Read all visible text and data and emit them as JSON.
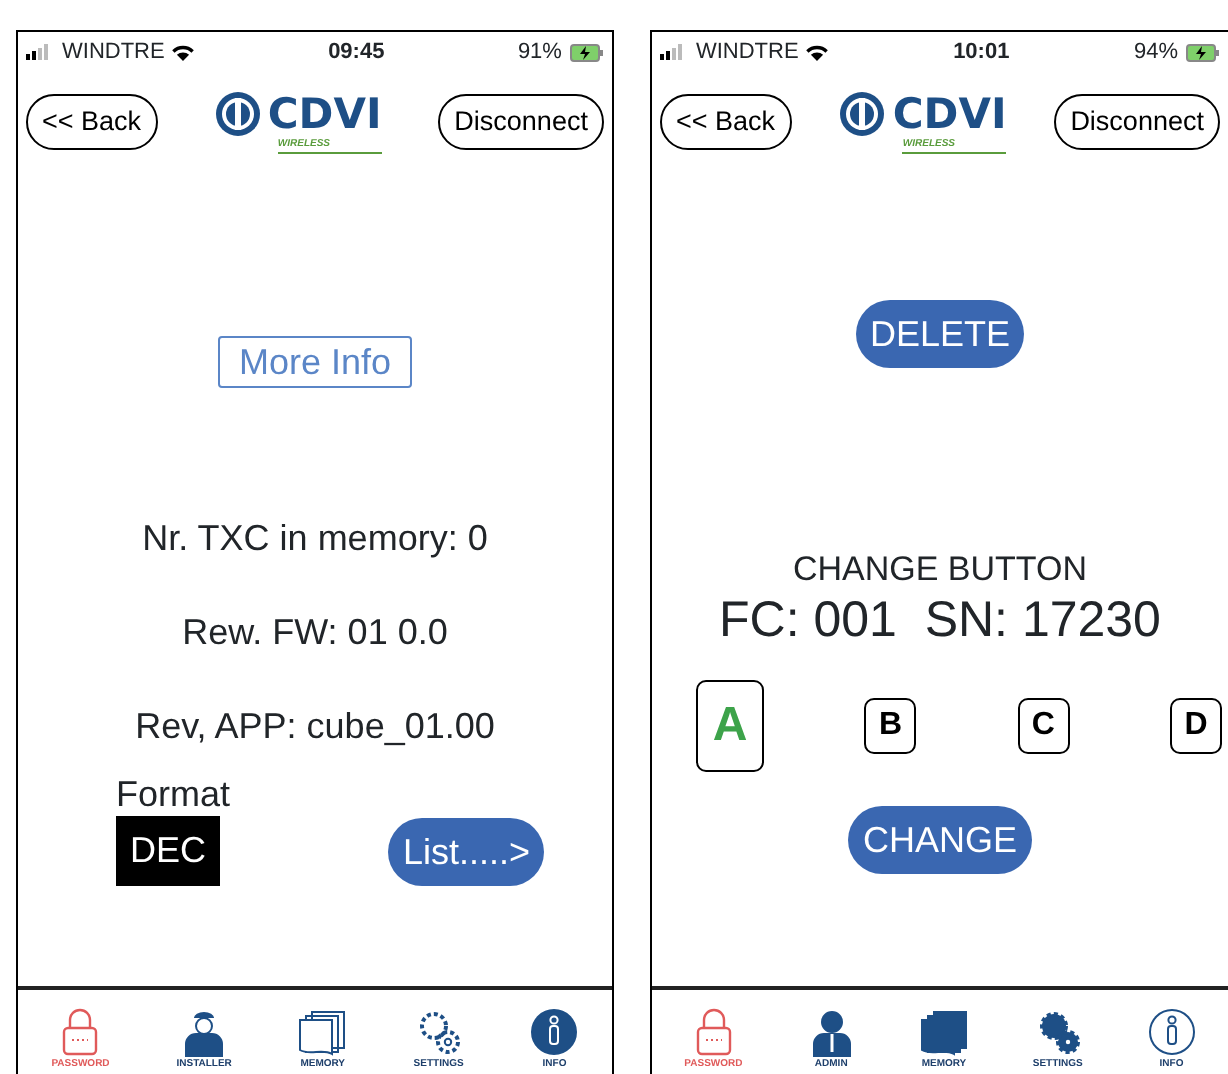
{
  "screens": [
    {
      "kind": "info",
      "status_bar": {
        "carrier": "WINDTRE",
        "time": "09:45",
        "battery": "91%"
      },
      "header": {
        "back": "<< Back",
        "logo": "CDVI",
        "logo_tagline": "WIRELESS",
        "disconnect": "Disconnect"
      },
      "more_info": "More Info",
      "lines": [
        "Nr. TXC in memory: 0",
        "Rew. FW: 01 0.0",
        "Rev, APP: cube_01.00"
      ],
      "format": {
        "label": "Format",
        "value": "DEC"
      },
      "list_button": "List.....>",
      "tab_bar": [
        {
          "kind": "password",
          "label": "PASSWORD",
          "filled": false
        },
        {
          "kind": "installer",
          "label": "INSTALLER",
          "filled": true
        },
        {
          "kind": "memory",
          "label": "MEMORY",
          "filled": false
        },
        {
          "kind": "settings",
          "label": "SETTINGS",
          "filled": false
        },
        {
          "kind": "info",
          "label": "INFO",
          "filled": true
        }
      ]
    },
    {
      "kind": "change",
      "status_bar": {
        "carrier": "WINDTRE",
        "time": "10:01",
        "battery": "94%"
      },
      "header": {
        "back": "<< Back",
        "logo": "CDVI",
        "logo_tagline": "WIRELESS",
        "disconnect": "Disconnect"
      },
      "delete_button": "DELETE",
      "title": "CHANGE BUTTON",
      "code_line": "FC: 001  SN: 17230",
      "keys": [
        {
          "label": "A",
          "selected": true
        },
        {
          "label": "B",
          "selected": false
        },
        {
          "label": "C",
          "selected": false
        },
        {
          "label": "D",
          "selected": false
        }
      ],
      "change_button": "CHANGE",
      "tab_bar": [
        {
          "kind": "password",
          "label": "PASSWORD",
          "filled": false
        },
        {
          "kind": "admin",
          "label": "ADMIN",
          "filled": true
        },
        {
          "kind": "memory",
          "label": "MEMORY",
          "filled": true
        },
        {
          "kind": "settings",
          "label": "SETTINGS",
          "filled": true
        },
        {
          "kind": "info",
          "label": "INFO",
          "filled": false
        }
      ]
    }
  ]
}
